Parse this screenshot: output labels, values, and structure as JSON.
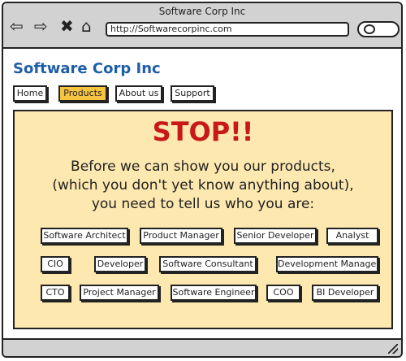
{
  "window": {
    "title": "Software Corp Inc"
  },
  "browser": {
    "url": "http://Softwarecorpinc.com",
    "icons": [
      "back-arrow-icon",
      "forward-arrow-icon",
      "close-x-icon",
      "home-icon",
      "search-icon"
    ]
  },
  "site": {
    "title": "Software Corp Inc"
  },
  "nav": {
    "items": [
      {
        "label": "Home",
        "active": false
      },
      {
        "label": "Products",
        "active": true
      },
      {
        "label": "About us",
        "active": false
      },
      {
        "label": "Support",
        "active": false
      }
    ]
  },
  "panel": {
    "heading": "STOP!!",
    "lines": [
      "Before we can show you our products,",
      "(which you don't yet know anything about),",
      "you need to tell us who you are:"
    ]
  },
  "roles": [
    "Software Architect",
    "Product Manager",
    "Senior Developer",
    "Analyst",
    "CIO",
    "Developer",
    "Software Consultant",
    "Development Manager",
    "CTO",
    "Project Manager",
    "Software Engineer",
    "COO",
    "BI Developer"
  ],
  "colors": {
    "accent": "#f5c542",
    "panel": "#fde8b0",
    "stop": "#c81818",
    "title": "#1f5fa6"
  }
}
